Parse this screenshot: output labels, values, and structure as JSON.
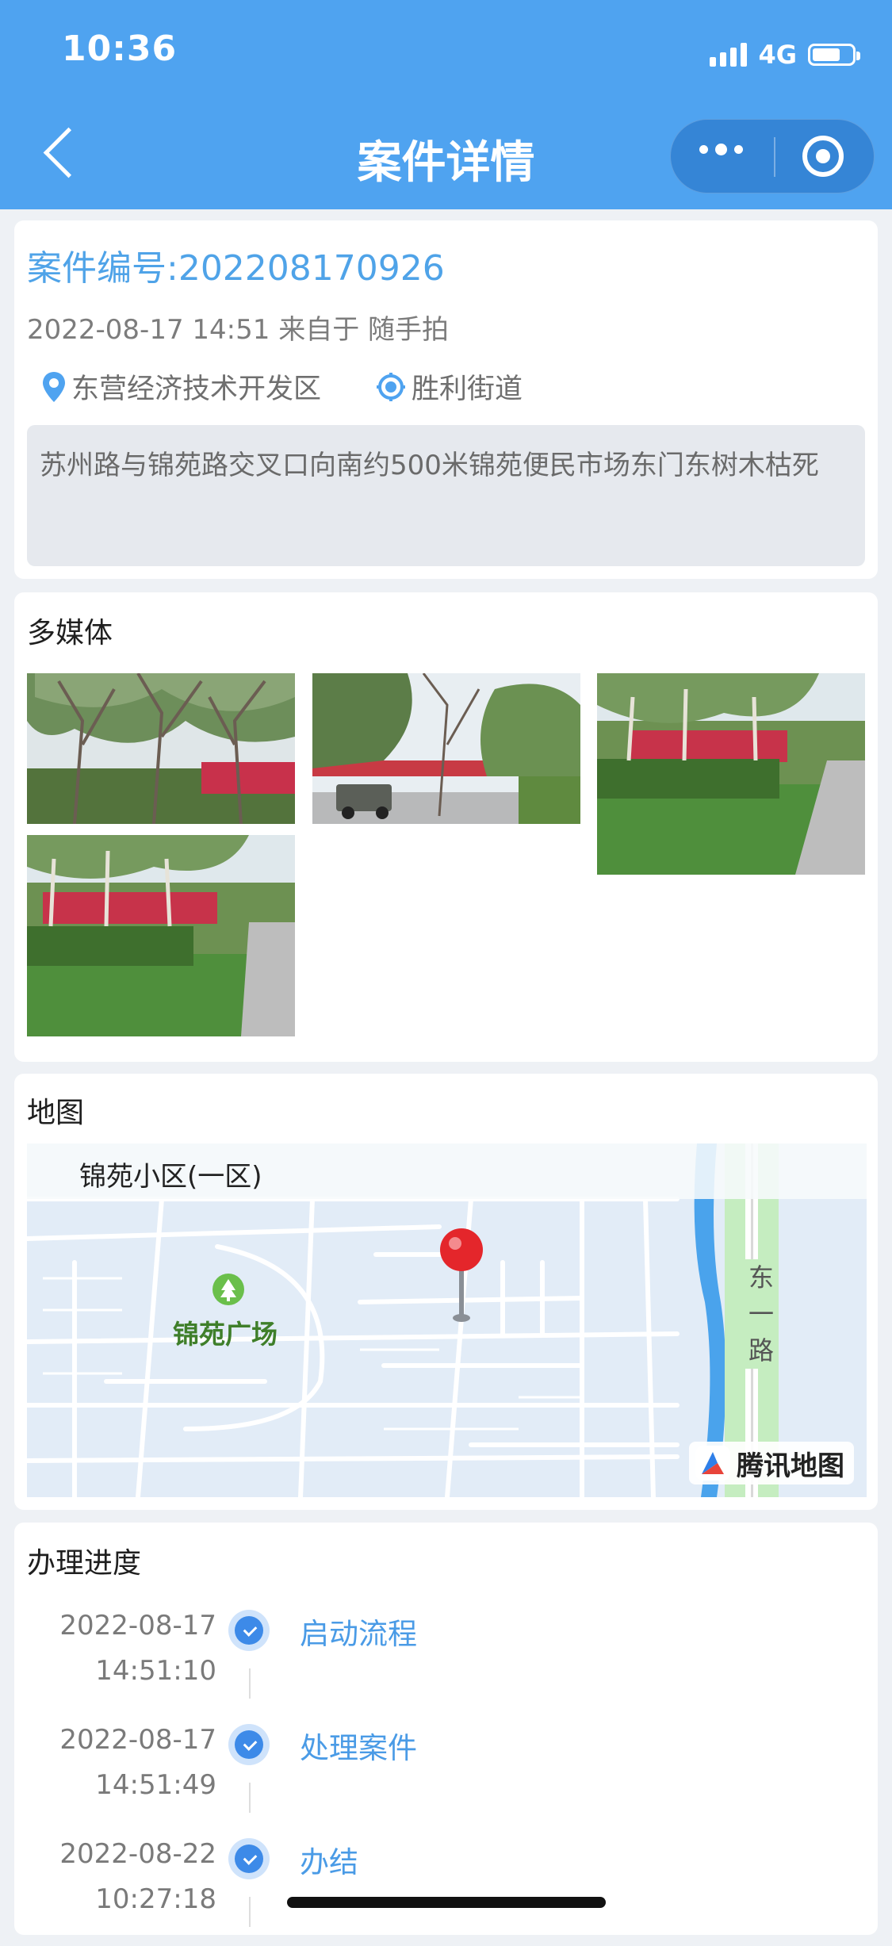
{
  "status_bar": {
    "time": "10:36",
    "network": "4G",
    "battery_level": 0.7
  },
  "nav": {
    "title": "案件详情",
    "back_icon": "chevron-left-icon",
    "more_icon": "more-dots-icon",
    "close_icon": "target-close-icon"
  },
  "case": {
    "number_label": "案件编号:202208170926",
    "meta": "2022-08-17 14:51 来自于 随手拍",
    "district": "东营经济技术开发区",
    "street": "胜利街道",
    "description": "苏州路与锦苑路交叉口向南约500米锦苑便民市场东门东树木枯死"
  },
  "media": {
    "title": "多媒体",
    "photo_count": 4
  },
  "map": {
    "title": "地图",
    "poi_top": "锦苑小区(一区)",
    "poi_park": "锦苑广场",
    "road_label": "东一路",
    "provider": "腾讯地图"
  },
  "progress": {
    "title": "办理进度",
    "steps": [
      {
        "date": "2022-08-17",
        "time": "14:51:10",
        "label": "启动流程"
      },
      {
        "date": "2022-08-17",
        "time": "14:51:49",
        "label": "处理案件"
      },
      {
        "date": "2022-08-22",
        "time": "10:27:18",
        "label": "办结"
      }
    ]
  },
  "colors": {
    "header": "#4fa3f0",
    "accent": "#4a9be6",
    "step_dot": "#3d8ae8"
  }
}
